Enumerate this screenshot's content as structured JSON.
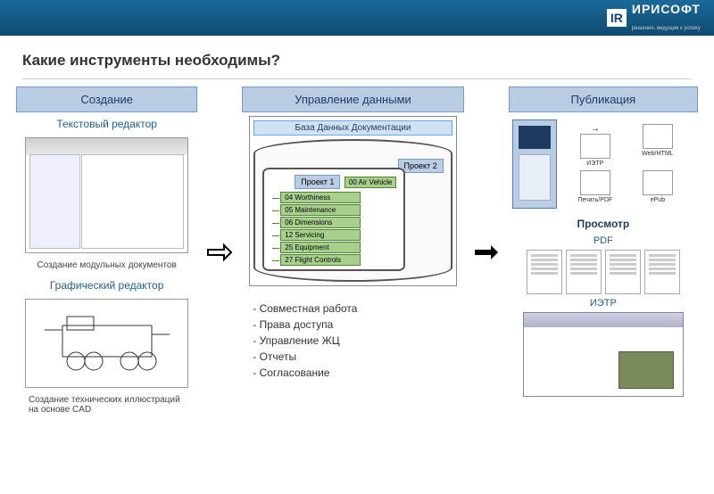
{
  "brand": {
    "code": "IR",
    "name": "ИРИСОФТ",
    "tag": "решения, ведущие к успеху"
  },
  "title": "Какие инструменты необходимы?",
  "col1": {
    "header": "Создание",
    "sub1": "Текстовый редактор",
    "cap1": "Создание модульных документов",
    "sub2": "Графический редактор",
    "cap2": "Создание технических иллюстраций на основе CAD"
  },
  "col2": {
    "header": "Управление данными",
    "db_title": "База Данных Документации",
    "proj1": "Проект 1",
    "proj2": "Проект 2",
    "tree": {
      "root": "00 Air Vehicle",
      "items": [
        "04 Worthiness",
        "05 Maintenance",
        "06 Dimensions",
        "12 Servicing",
        "25 Equipment",
        "27 Flight Controls"
      ]
    },
    "bullets": [
      "- Совместная работа",
      "- Права доступа",
      " - Управление ЖЦ",
      "- Отчеты",
      "- Согласование"
    ]
  },
  "col3": {
    "header": "Публикация",
    "outputs": [
      {
        "label": "ИЭТР"
      },
      {
        "label": "Web/HTML"
      },
      {
        "label": "Печать/PDF"
      },
      {
        "label": "ePub"
      }
    ],
    "view": "Просмотр",
    "pdf": "PDF",
    "ietr": "ИЭТР"
  }
}
